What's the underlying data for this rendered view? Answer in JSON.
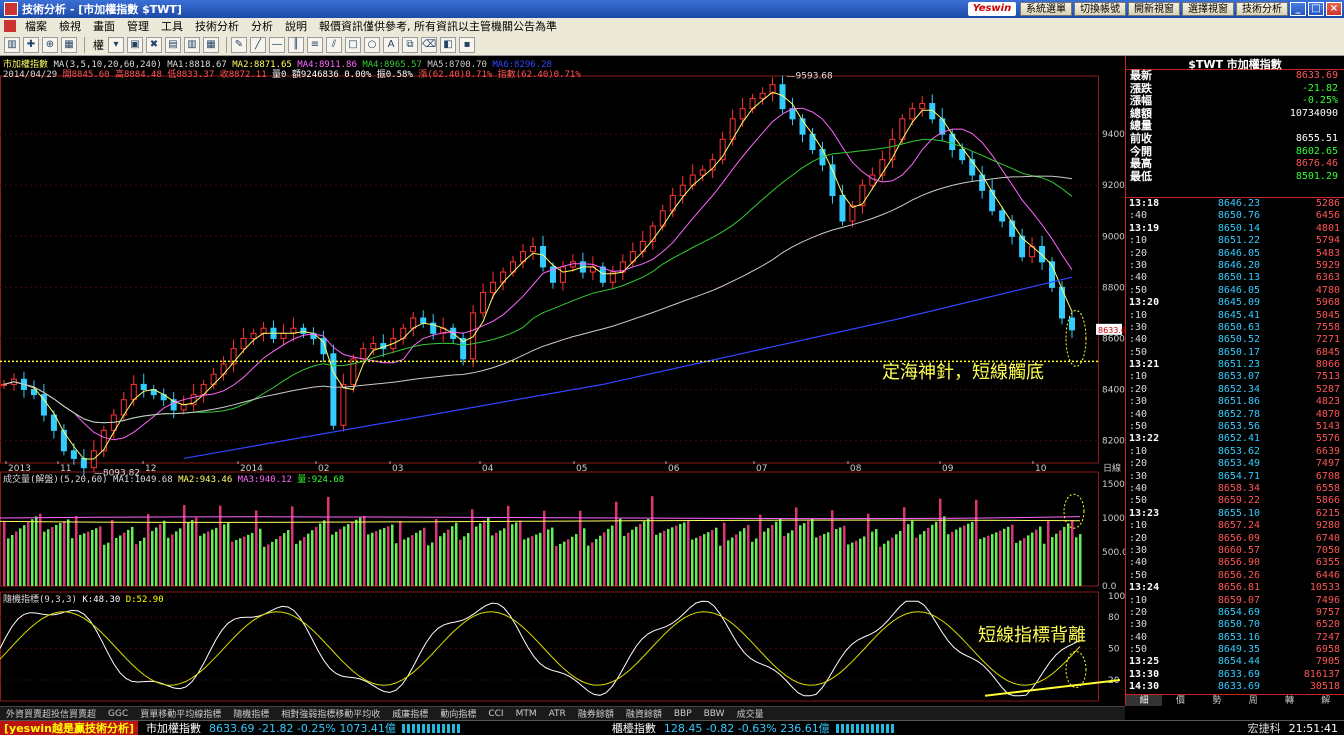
{
  "window": {
    "title": "技術分析 - [市加權指數 $TWT]",
    "brand_logo": "Yeswin",
    "top_buttons": [
      "系統選單",
      "切換帳號",
      "開新視窗",
      "選擇視窗",
      "技術分析"
    ],
    "controls": [
      "_",
      "□",
      "×"
    ]
  },
  "menu": {
    "items": [
      "檔案",
      "檢視",
      "畫面",
      "管理",
      "工具",
      "技術分析",
      "分析",
      "說明",
      "報價資訊僅供參考, 所有資訊以主管機關公告為準"
    ]
  },
  "toolbar": {
    "weight_label": "權"
  },
  "legend": {
    "line1_name": "市加權指數",
    "ma1": "MA(3,5,10,20,60,240) MA1:8818.67",
    "ma2": "MA2:8871.65",
    "ma3": "MA4:8911.86",
    "ma4": "MA4:8965.57",
    "ma5": "MA5:8700.70",
    "ma6": "MA6:8296.28",
    "line2_date": "2014/04/29",
    "open": "開8845.60",
    "high": "高8884.48",
    "low": "低8833.37",
    "close": "收8872.11",
    "vol": "量0 額9246836",
    "chg1": "0.00%",
    "swing": "振0.58%",
    "chg2": "漲(62.40)0.71%",
    "idx": "指數(62.40)0.71%"
  },
  "volume_legend": {
    "name": "成交量(解盤)(5,20,60)",
    "ma1": "MA1:1049.68",
    "ma2": "MA2:943.46",
    "ma3": "MA3:940.12",
    "vol": "量:924.68"
  },
  "kd_legend": {
    "name": "隨機指標(9,3,3)",
    "k": "K:48.30",
    "d": "D:52.90"
  },
  "annotations": {
    "price_note": "定海神針，短線觸底",
    "kd_note": "短線指標背離"
  },
  "chart_data": [
    {
      "type": "line",
      "title": "市加權指數",
      "x_labels": [
        "2013",
        "11",
        "12",
        "2014",
        "02",
        "03",
        "04",
        "05",
        "06",
        "07",
        "08",
        "09",
        "10",
        "日線"
      ],
      "y_ticks": [
        8200.0,
        8400.0,
        8600.0,
        8800.0,
        9000.0,
        9200.0,
        9400.0
      ],
      "ylim": [
        8120,
        9620
      ],
      "annotations": [
        "9593.68",
        "8093.82",
        "8633.69"
      ],
      "support_level": 8510,
      "close": [
        8420,
        8440,
        8400,
        8380,
        8300,
        8240,
        8160,
        8130,
        8093.82,
        8160,
        8240,
        8300,
        8360,
        8420,
        8400,
        8380,
        8360,
        8320,
        8340,
        8380,
        8420,
        8460,
        8500,
        8560,
        8600,
        8620,
        8640,
        8600,
        8620,
        8640,
        8620,
        8600,
        8540,
        8260,
        8420,
        8520,
        8560,
        8580,
        8560,
        8600,
        8640,
        8680,
        8660,
        8620,
        8640,
        8600,
        8520,
        8700,
        8780,
        8820,
        8860,
        8900,
        8940,
        8960,
        8880,
        8820,
        8880,
        8900,
        8860,
        8880,
        8820,
        8860,
        8900,
        8940,
        8980,
        9040,
        9100,
        9160,
        9200,
        9240,
        9260,
        9300,
        9380,
        9460,
        9500,
        9540,
        9560,
        9593.68,
        9500,
        9460,
        9400,
        9340,
        9280,
        9160,
        9060,
        9120,
        9200,
        9240,
        9300,
        9380,
        9460,
        9500,
        9520,
        9460,
        9400,
        9340,
        9300,
        9240,
        9180,
        9100,
        9060,
        9000,
        8920,
        8960,
        8900,
        8800,
        8680,
        8633.69
      ],
      "series": [
        {
          "name": "MA5",
          "color": "#ffff66"
        },
        {
          "name": "MA10",
          "color": "#ff66ff"
        },
        {
          "name": "MA20",
          "color": "#33cc33"
        },
        {
          "name": "MA60",
          "color": "#cccccc"
        },
        {
          "name": "MA240",
          "color": "#3344ff"
        }
      ]
    },
    {
      "type": "bar",
      "title": "成交量(解盤)(5,20,60)",
      "y_ticks": [
        0.0,
        500.0,
        1000.0,
        1500.0
      ],
      "ylim": [
        0,
        1500
      ]
    },
    {
      "type": "line",
      "title": "隨機指標(9,3,3)",
      "y_ticks": [
        20,
        50,
        80,
        100
      ],
      "ylim": [
        0,
        100
      ],
      "series": [
        {
          "name": "K",
          "color": "#ffffff"
        },
        {
          "name": "D",
          "color": "#dddd00"
        }
      ]
    }
  ],
  "quote_panel": {
    "header": "$TWT 市加權指數",
    "summary": [
      {
        "label": "最新",
        "value": "8633.69",
        "color": "#ff5555"
      },
      {
        "label": "漲跌",
        "value": "-21.82",
        "color": "#33ff33"
      },
      {
        "label": "漲幅",
        "value": "-0.25%",
        "color": "#33ff33"
      },
      {
        "label": "總額",
        "value": "10734090",
        "color": "#ffffff"
      },
      {
        "label": "總量",
        "value": "",
        "color": "#ffffff"
      },
      {
        "label": "前收",
        "value": "8655.51",
        "color": "#ffffff"
      },
      {
        "label": "今開",
        "value": "8602.65",
        "color": "#33ff33"
      },
      {
        "label": "最高",
        "value": "8676.46",
        "color": "#ff5555"
      },
      {
        "label": "最低",
        "value": "8501.29",
        "color": "#33ff33"
      }
    ],
    "ticks": [
      {
        "time": "13:18",
        "price": "8646.23",
        "vol": "5286",
        "c": "#33ccff",
        "major": true
      },
      {
        "time": ":40",
        "price": "8650.76",
        "vol": "6456",
        "c": "#33ccff"
      },
      {
        "time": "13:19",
        "price": "8650.14",
        "vol": "4801",
        "c": "#33ccff",
        "major": true
      },
      {
        "time": ":10",
        "price": "8651.22",
        "vol": "5794",
        "c": "#33ccff"
      },
      {
        "time": ":20",
        "price": "8646.05",
        "vol": "5483",
        "c": "#33ccff"
      },
      {
        "time": ":30",
        "price": "8646.20",
        "vol": "5929",
        "c": "#33ccff"
      },
      {
        "time": ":40",
        "price": "8650.13",
        "vol": "6363",
        "c": "#33ccff"
      },
      {
        "time": ":50",
        "price": "8646.05",
        "vol": "4780",
        "c": "#33ccff"
      },
      {
        "time": "13:20",
        "price": "8645.09",
        "vol": "5968",
        "c": "#33ccff",
        "major": true
      },
      {
        "time": ":10",
        "price": "8645.41",
        "vol": "5045",
        "c": "#33ccff"
      },
      {
        "time": ":30",
        "price": "8650.63",
        "vol": "7558",
        "c": "#33ccff"
      },
      {
        "time": ":40",
        "price": "8650.52",
        "vol": "7271",
        "c": "#33ccff"
      },
      {
        "time": ":50",
        "price": "8650.17",
        "vol": "6845",
        "c": "#33ccff"
      },
      {
        "time": "13:21",
        "price": "8651.23",
        "vol": "8066",
        "c": "#33ccff",
        "major": true
      },
      {
        "time": ":10",
        "price": "8653.07",
        "vol": "7513",
        "c": "#33ccff"
      },
      {
        "time": ":20",
        "price": "8652.34",
        "vol": "5287",
        "c": "#33ccff"
      },
      {
        "time": ":30",
        "price": "8651.86",
        "vol": "4823",
        "c": "#33ccff"
      },
      {
        "time": ":40",
        "price": "8652.78",
        "vol": "4870",
        "c": "#33ccff"
      },
      {
        "time": ":50",
        "price": "8653.56",
        "vol": "5143",
        "c": "#33ccff"
      },
      {
        "time": "13:22",
        "price": "8652.41",
        "vol": "5576",
        "c": "#33ccff",
        "major": true
      },
      {
        "time": ":10",
        "price": "8653.62",
        "vol": "6639",
        "c": "#33ccff"
      },
      {
        "time": ":20",
        "price": "8653.49",
        "vol": "7497",
        "c": "#33ccff"
      },
      {
        "time": ":30",
        "price": "8654.71",
        "vol": "6708",
        "c": "#33ccff"
      },
      {
        "time": ":40",
        "price": "8658.34",
        "vol": "6558",
        "c": "#ff5555"
      },
      {
        "time": ":50",
        "price": "8659.22",
        "vol": "5866",
        "c": "#ff5555"
      },
      {
        "time": "13:23",
        "price": "8655.10",
        "vol": "6215",
        "c": "#33ccff",
        "major": true
      },
      {
        "time": ":10",
        "price": "8657.24",
        "vol": "9280",
        "c": "#ff5555"
      },
      {
        "time": ":20",
        "price": "8656.09",
        "vol": "6740",
        "c": "#ff5555"
      },
      {
        "time": ":30",
        "price": "8660.57",
        "vol": "7050",
        "c": "#ff5555"
      },
      {
        "time": ":40",
        "price": "8656.90",
        "vol": "6355",
        "c": "#ff5555"
      },
      {
        "time": ":50",
        "price": "8656.26",
        "vol": "6446",
        "c": "#ff5555"
      },
      {
        "time": "13:24",
        "price": "8656.81",
        "vol": "10533",
        "c": "#ff5555",
        "major": true
      },
      {
        "time": ":10",
        "price": "8659.07",
        "vol": "7496",
        "c": "#ff5555"
      },
      {
        "time": ":20",
        "price": "8654.69",
        "vol": "9757",
        "c": "#33ccff"
      },
      {
        "time": ":30",
        "price": "8650.70",
        "vol": "6520",
        "c": "#33ccff"
      },
      {
        "time": ":40",
        "price": "8653.16",
        "vol": "7247",
        "c": "#33ccff"
      },
      {
        "time": ":50",
        "price": "8649.35",
        "vol": "6958",
        "c": "#33ccff"
      },
      {
        "time": "13:25",
        "price": "8654.44",
        "vol": "7905",
        "c": "#33ccff",
        "major": true
      },
      {
        "time": "13:30",
        "price": "8633.69",
        "vol": "816137",
        "c": "#33ccff",
        "major": true
      },
      {
        "time": "14:30",
        "price": "8633.69",
        "vol": "30518",
        "c": "#33ccff",
        "major": true
      }
    ],
    "tabs": [
      "細",
      "價",
      "勢",
      "周",
      "轉",
      "解"
    ]
  },
  "indicator_tabs": [
    "外資買賣超投信買賣超",
    "GGC",
    "買單移動平均線指標",
    "隨機指標",
    "相對強弱指標移動平均收",
    "威廉指標",
    "動向指標",
    "CCI",
    "MTM",
    "ATR",
    "融券餘額",
    "融資餘額",
    "BBP",
    "BBW",
    "成交量"
  ],
  "statusbar": {
    "brand": "[yeswin越是贏技術分析]",
    "index1": "市加權指數",
    "index1_val": "8633.69 -21.82 -0.25% 1073.41億",
    "index2": "櫃檯指數",
    "index2_val": "128.45 -0.82 -0.63% 236.61億",
    "source": "宏捷科",
    "time": "21:51:41"
  }
}
